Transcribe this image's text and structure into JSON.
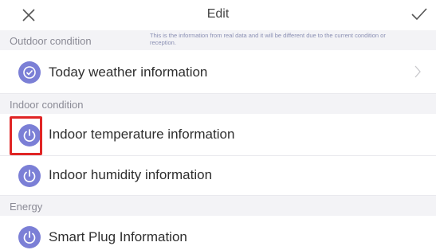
{
  "header": {
    "title": "Edit",
    "close_icon": "close-icon",
    "confirm_icon": "check-icon"
  },
  "sections": {
    "outdoor": {
      "label": "Outdoor condition",
      "note": "This is the information from real data and it will be different due to the current condition or reception."
    },
    "indoor": {
      "label": "Indoor condition"
    },
    "energy": {
      "label": "Energy"
    }
  },
  "rows": {
    "weather": {
      "label": "Today weather information",
      "icon": "check-circle-icon"
    },
    "temperature": {
      "label": "Indoor temperature information",
      "icon": "power-icon"
    },
    "humidity": {
      "label": "Indoor humidity information",
      "icon": "power-icon"
    },
    "plug": {
      "label": "Smart Plug Information",
      "icon": "power-icon"
    }
  },
  "colors": {
    "accent": "#7b7fd6",
    "section_bg": "#f3f3f6",
    "highlight": "#e02525"
  }
}
